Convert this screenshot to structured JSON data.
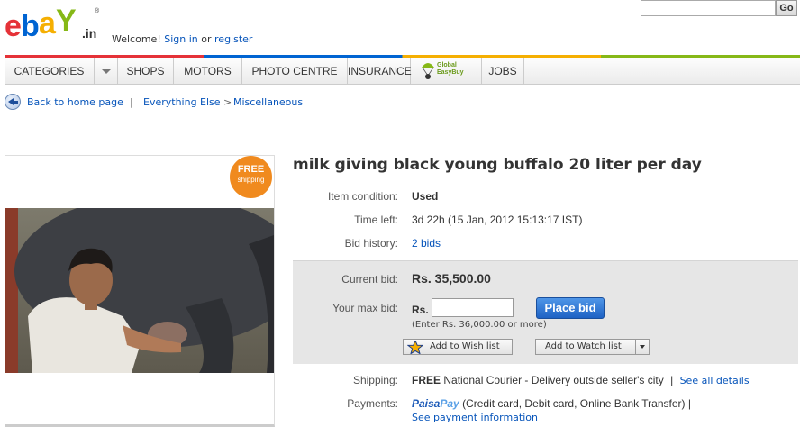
{
  "header": {
    "logo_text": "ebaY.in",
    "welcome_text": "Welcome!",
    "sign_in": "Sign in",
    "or_text": "or",
    "register": "register",
    "search_button": "Go"
  },
  "nav": {
    "items": [
      "CATEGORIES",
      "SHOPS",
      "MOTORS",
      "PHOTO CENTRE",
      "INSURANCE",
      "JOBS"
    ],
    "global_easybuy": "Global EasyBuy"
  },
  "breadcrumb": {
    "back": "Back to home page",
    "pipe": "|",
    "cat1": "Everything Else",
    "sep": ">",
    "cat2": "Miscellaneous"
  },
  "listing": {
    "free_badge_top": "FREE",
    "free_badge_bottom": "shipping",
    "title": "milk giving black young buffalo 20 liter per day",
    "condition_label": "Item condition:",
    "condition_value": "Used",
    "time_label": "Time left:",
    "time_value": "3d 22h (15 Jan, 2012 15:13:17 IST)",
    "history_label": "Bid history:",
    "history_value": "2 bids",
    "current_bid_label": "Current bid:",
    "current_bid_value": "Rs. 35,500.00",
    "max_bid_label": "Your max bid:",
    "currency": "Rs.",
    "place_bid": "Place bid",
    "bid_hint": "(Enter Rs. 36,000.00 or more)",
    "wish_list": "Add to Wish list",
    "watch_list": "Add to Watch list",
    "shipping_label": "Shipping:",
    "shipping_free": "FREE",
    "shipping_value": "National Courier - Delivery outside seller's city",
    "shipping_pipe": "|",
    "see_details": "See all details",
    "payments_label": "Payments:",
    "paisapay_1": "Paisa",
    "paisapay_2": "Pay",
    "payments_value": "(Credit card, Debit card, Online Bank Transfer) |",
    "payment_info_link": "See payment information"
  },
  "colors": {
    "ebay_red": "#e53238",
    "ebay_blue": "#0064d2",
    "ebay_yellow": "#f5af02",
    "ebay_green": "#86b817",
    "link_blue": "#0654ba",
    "badge_orange": "#f08a1e"
  }
}
